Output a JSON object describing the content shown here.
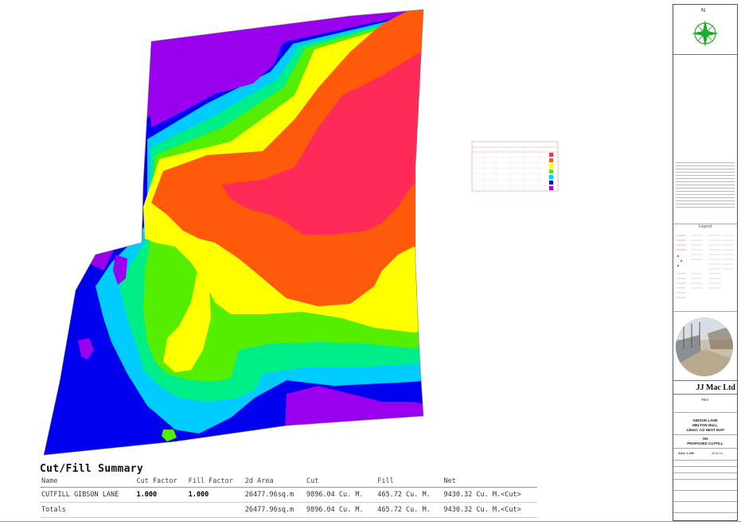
{
  "map": {
    "colors": {
      "band1": "#ff2a55",
      "band2": "#ff5a0a",
      "band3": "#ffff00",
      "band4": "#55ee00",
      "band5": "#00ee88",
      "band6": "#00ccff",
      "band7": "#0000ee",
      "band8": "#9900ee"
    }
  },
  "summary": {
    "title": "Cut/Fill Summary",
    "headers": [
      "Name",
      "Cut Factor",
      "Fill Factor",
      "2d Area",
      "Cut",
      "Fill",
      "Net"
    ],
    "rows": [
      [
        "CUTFILL GIBSON LANE",
        "1.000",
        "1.000",
        "26477.96sq.m",
        "9896.04 Cu. M.",
        "465.72 Cu. M.",
        "9430.32 Cu. M.<Cut>"
      ],
      [
        "Totals",
        "",
        "",
        "26477.96sq.m",
        "9896.04 Cu. M.",
        "465.72 Cu. M.",
        "9430.32 Cu. M.<Cut>"
      ]
    ]
  },
  "title_block": {
    "north_label": "N",
    "legend_label": "Legend",
    "company": "JJ Mac Ltd",
    "rev": "REV",
    "project_line1": "GIBSON LANE",
    "project_line2": "MELTON HULL",
    "project_line3": "JJMAC rv2 HEAT MAP",
    "on_label": "ON",
    "subject": "PROPOSED CUTFILL",
    "scale": "A3@ 1:250",
    "date": "25-6-24"
  },
  "icons": {
    "compass": "compass-rose-icon"
  }
}
